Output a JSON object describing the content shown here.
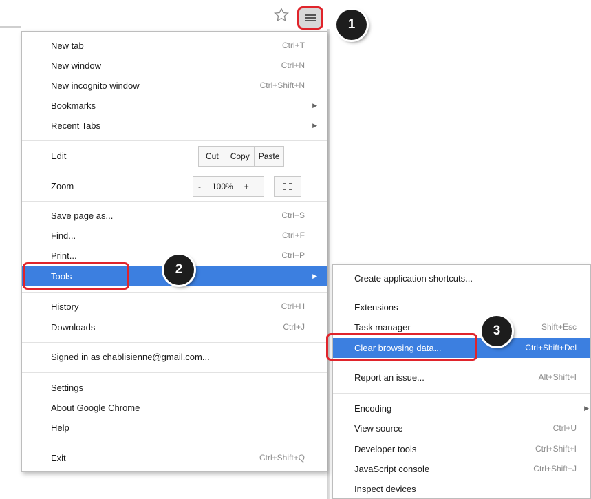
{
  "menu": {
    "top_items": [
      {
        "label": "New tab",
        "shortcut": "Ctrl+T"
      },
      {
        "label": "New window",
        "shortcut": "Ctrl+N"
      },
      {
        "label": "New incognito window",
        "shortcut": "Ctrl+Shift+N"
      },
      {
        "label": "Bookmarks",
        "arrow": "▶"
      },
      {
        "label": "Recent Tabs",
        "arrow": "▶"
      }
    ],
    "edit": {
      "label": "Edit",
      "cut": "Cut",
      "copy": "Copy",
      "paste": "Paste"
    },
    "zoom": {
      "label": "Zoom",
      "minus": "-",
      "value": "100%",
      "plus": "+"
    },
    "page_items": [
      {
        "label": "Save page as...",
        "shortcut": "Ctrl+S"
      },
      {
        "label": "Find...",
        "shortcut": "Ctrl+F"
      },
      {
        "label": "Print...",
        "shortcut": "Ctrl+P"
      }
    ],
    "tools": {
      "label": "Tools",
      "arrow": "▶"
    },
    "history": {
      "label": "History",
      "shortcut": "Ctrl+H"
    },
    "downloads": {
      "label": "Downloads",
      "shortcut": "Ctrl+J"
    },
    "signed_in": "Signed in as chablisienne@gmail.com...",
    "settings": "Settings",
    "about": "About Google Chrome",
    "help": "Help",
    "exit": {
      "label": "Exit",
      "shortcut": "Ctrl+Shift+Q"
    }
  },
  "submenu": {
    "create_shortcuts": "Create application shortcuts...",
    "extensions": "Extensions",
    "task_manager": {
      "label": "Task manager",
      "shortcut": "Shift+Esc"
    },
    "clear_data": {
      "label": "Clear browsing data...",
      "shortcut": "Ctrl+Shift+Del"
    },
    "report": {
      "label": "Report an issue...",
      "shortcut": "Alt+Shift+I"
    },
    "encoding": {
      "label": "Encoding",
      "arrow": "▶"
    },
    "view_source": {
      "label": "View source",
      "shortcut": "Ctrl+U"
    },
    "dev_tools": {
      "label": "Developer tools",
      "shortcut": "Ctrl+Shift+I"
    },
    "js_console": {
      "label": "JavaScript console",
      "shortcut": "Ctrl+Shift+J"
    },
    "inspect": {
      "label": "Inspect devices"
    }
  },
  "callouts": [
    "1",
    "2",
    "3"
  ],
  "icons": {
    "star": "star-icon",
    "menu": "hamburger-menu-icon"
  },
  "colors": {
    "highlight": "#3c7fe0",
    "annotation_red": "#e0242b",
    "callout": "#1d1d1d"
  }
}
